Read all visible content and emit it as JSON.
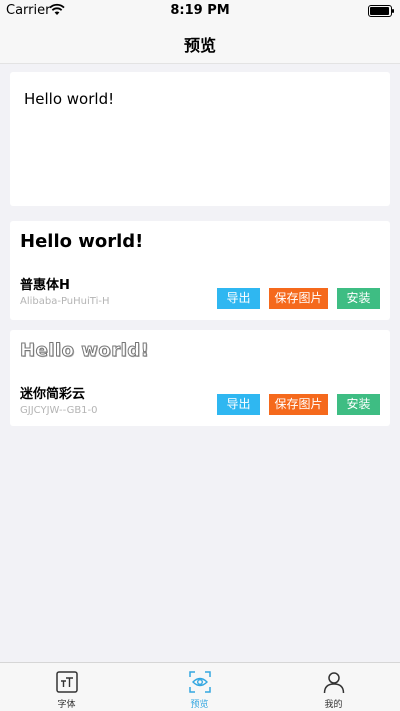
{
  "status_bar": {
    "carrier": "Carrier",
    "time": "8:19 PM",
    "battery_level": 0.95
  },
  "nav": {
    "title": "预览"
  },
  "input_text": "Hello world!",
  "fonts": [
    {
      "preview": "Hello world!",
      "name": "普惠体H",
      "id": "Alibaba-PuHuiTi-H"
    },
    {
      "preview": "Hello world!",
      "name": "迷你简彩云",
      "id": "GJJCYJW--GB1-0"
    }
  ],
  "buttons": {
    "export": "导出",
    "save_image": "保存图片",
    "install": "安装"
  },
  "tabs": [
    {
      "label": "字体",
      "icon": "font-icon"
    },
    {
      "label": "预览",
      "icon": "preview-eye-icon",
      "active": true
    },
    {
      "label": "我的",
      "icon": "user-icon"
    }
  ],
  "colors": {
    "export_button": "#2fb7f1",
    "save_button": "#f5691c",
    "install_button": "#3ebd83",
    "active_tab": "#34a7e1"
  }
}
